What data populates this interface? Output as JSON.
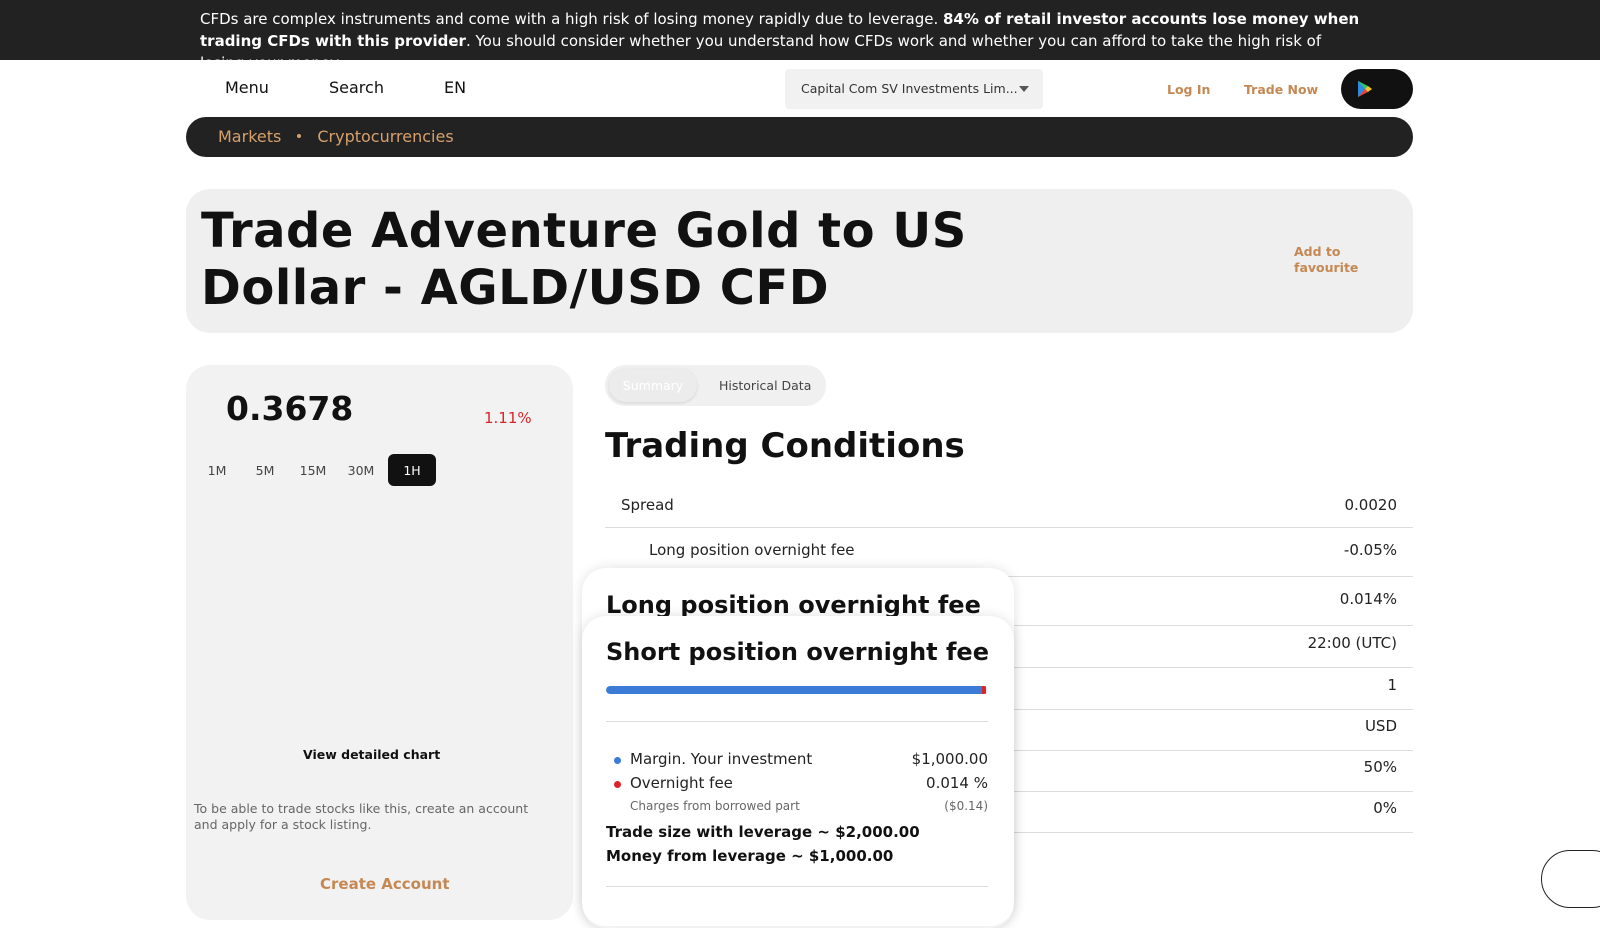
{
  "risk_warning": {
    "part1": "CFDs are complex instruments and come with a high risk of losing money rapidly due to leverage. ",
    "bold": "84% of retail investor accounts lose money when trading CFDs with this provider",
    "part2": ". You should consider whether you understand how CFDs work and whether you can afford to take the high risk of losing your money."
  },
  "nav": {
    "menu": "Menu",
    "search": "Search",
    "language": "EN",
    "entity": "Capital Com SV Investments Lim...",
    "login": "Log In",
    "trade_now": "Trade Now",
    "play_icon": "google-play-icon"
  },
  "breadcrumb": [
    "Markets",
    "Cryptocurrencies"
  ],
  "hero": {
    "title": "Trade Adventure Gold to US Dollar - AGLD/USD CFD",
    "favourite": "Add to favourite"
  },
  "price_card": {
    "price": "0.3678",
    "change": "1.11%",
    "timeframes": [
      "1M",
      "5M",
      "15M",
      "30M",
      "1H"
    ],
    "active_timeframe": "1H",
    "view_chart": "View detailed chart",
    "note": "To be able to trade stocks like this, create an account and apply for a stock listing.",
    "create_account": "Create Account"
  },
  "tabs": {
    "summary": "Summary",
    "historical": "Historical Data"
  },
  "trading_conditions": {
    "title": "Trading Conditions",
    "rows": [
      {
        "label": "Spread",
        "value": "0.0020"
      },
      {
        "label": "Long position overnight fee",
        "value": "-0.05%"
      },
      {
        "label": "",
        "value": "0.014%"
      },
      {
        "label": "",
        "value": "22:00 (UTC)"
      },
      {
        "label": "",
        "value": "1"
      },
      {
        "label": "",
        "value": "USD"
      },
      {
        "label": "",
        "value": "50%"
      },
      {
        "label": "",
        "value": "0%"
      }
    ]
  },
  "popup_long": {
    "title": "Long position overnight fee"
  },
  "popup_short": {
    "title": "Short position overnight fee",
    "margin_fraction": 0.985,
    "margin_label": "Margin. Your investment",
    "margin_value": "$1,000.00",
    "fee_label": "Overnight fee",
    "fee_value": "0.014 %",
    "fee_sub_label": "Charges from borrowed part",
    "fee_sub_value": "($0.14)",
    "trade_size": "Trade size with leverage ~ $2,000.00",
    "money_from_leverage": "Money from leverage ~ $1,000.00"
  },
  "colors": {
    "accent": "#c58853",
    "dark": "#222222",
    "negative": "#d9252a",
    "margin_blue": "#3b7bd6",
    "fee_red": "#d9252a"
  }
}
